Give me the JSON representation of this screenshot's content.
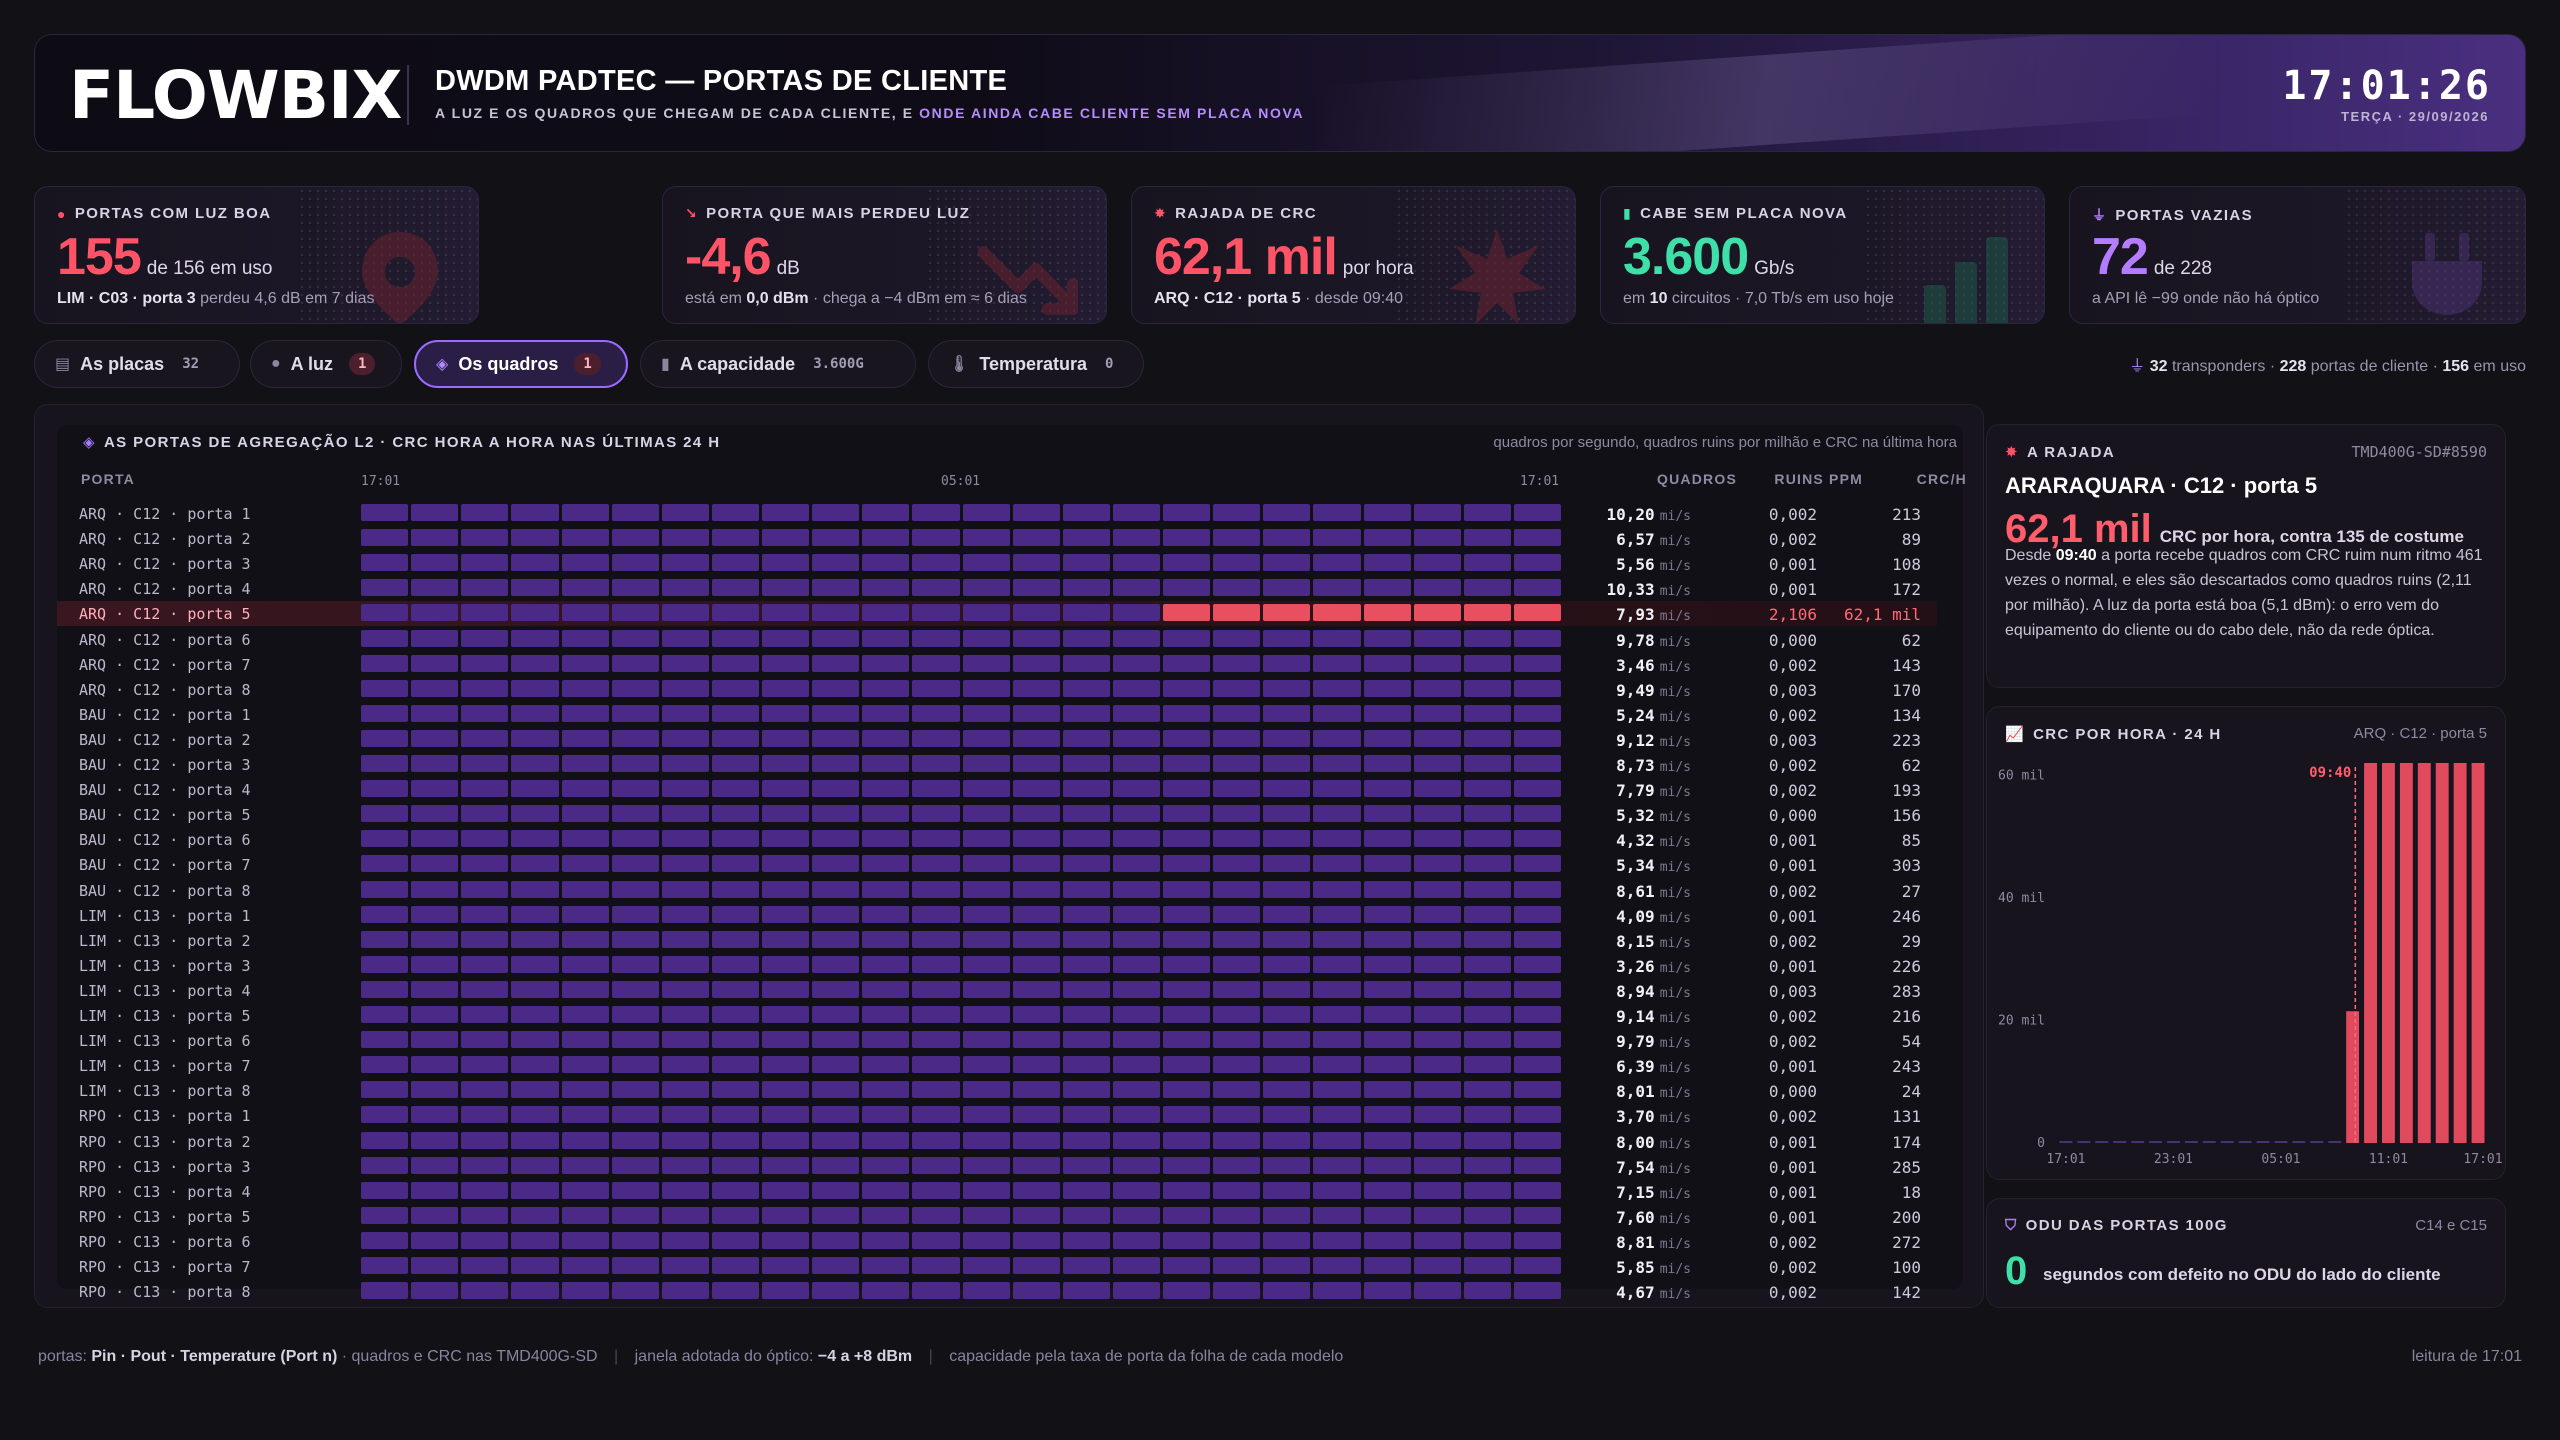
{
  "header": {
    "logo": "FLOWBIX",
    "title": "DWDM PADTEC — PORTAS DE CLIENTE",
    "subtitle_a": "A LUZ E OS QUADROS QUE CHEGAM DE CADA CLIENTE, E ",
    "subtitle_b": "ONDE AINDA CABE CLIENTE SEM PLACA NOVA",
    "clock": "17:01:26",
    "date": "TERÇA · 29/09/2026"
  },
  "kpis": [
    {
      "label": "PORTAS COM LUZ BOA",
      "value": "155",
      "unit": "de 156 em uso",
      "foot_b": "LIM · C03 · porta 3",
      "foot": " perdeu 4,6 dB em 7 dias",
      "color": "#ff5468",
      "icon": "pin-icon"
    },
    {
      "label": "PORTA QUE MAIS PERDEU LUZ",
      "value": "-4,6",
      "unit": "dB",
      "foot_a": "está em ",
      "foot_b": "0,0 dBm",
      "foot": " · chega a −4 dBm em ≈ 6 dias",
      "color": "#ff5468",
      "icon": "trend-down-icon"
    },
    {
      "label": "RAJADA DE CRC",
      "value": "62,1 mil",
      "unit": "por hora",
      "foot_b": "ARQ · C12 · porta 5",
      "foot": " · desde 09:40",
      "color": "#ff5468",
      "icon": "burst-icon"
    },
    {
      "label": "CABE SEM PLACA NOVA",
      "value": "3.600",
      "unit": "Gb/s",
      "foot_a": "em ",
      "foot_b": "10",
      "foot": " circuitos · 7,0 Tb/s em uso hoje",
      "color": "#3fe0a8",
      "icon": "bars-icon"
    },
    {
      "label": "PORTAS VAZIAS",
      "value": "72",
      "unit": "de 228",
      "foot": "a API lê −99 onde não há óptico",
      "color": "#b47cff",
      "icon": "plug-icon"
    }
  ],
  "tabs": [
    {
      "label": "As placas",
      "count": "32",
      "badge": false,
      "icon": "cards-icon"
    },
    {
      "label": "A luz",
      "count": "1",
      "badge": true,
      "icon": "pin-icon"
    },
    {
      "label": "Os quadros",
      "count": "1",
      "badge": true,
      "icon": "layers-icon",
      "active": true
    },
    {
      "label": "A capacidade",
      "count": "3.600G",
      "badge": false,
      "icon": "bars-icon"
    },
    {
      "label": "Temperatura",
      "count": "0",
      "badge": false,
      "icon": "thermo-icon"
    }
  ],
  "summary": {
    "transponders": "32",
    "transponders_label": "transponders",
    "ports": "228",
    "ports_label": "portas de cliente",
    "inuse": "156",
    "inuse_label": "em uso"
  },
  "panel": {
    "title": "AS PORTAS DE AGREGAÇÃO L2 · CRC HORA A HORA NAS ÚLTIMAS 24 H",
    "note": "quadros por segundo, quadros ruins por milhão e CRC na última hora",
    "col_port": "PORTA",
    "col_quadros": "QUADROS",
    "col_ppm": "RUINS PPM",
    "col_crc": "CRC/H",
    "ticks": [
      "17:01",
      "05:01",
      "17:01"
    ],
    "unit": "mi/s",
    "rows": [
      {
        "port": "ARQ · C12 · porta 1",
        "q": "10,20",
        "ppm": "0,002",
        "crc": "213"
      },
      {
        "port": "ARQ · C12 · porta 2",
        "q": "6,57",
        "ppm": "0,002",
        "crc": "89"
      },
      {
        "port": "ARQ · C12 · porta 3",
        "q": "5,56",
        "ppm": "0,001",
        "crc": "108"
      },
      {
        "port": "ARQ · C12 · porta 4",
        "q": "10,33",
        "ppm": "0,001",
        "crc": "172"
      },
      {
        "port": "ARQ · C12 · porta 5",
        "q": "7,93",
        "ppm": "2,106",
        "crc": "62,1 mil",
        "alert": true
      },
      {
        "port": "ARQ · C12 · porta 6",
        "q": "9,78",
        "ppm": "0,000",
        "crc": "62"
      },
      {
        "port": "ARQ · C12 · porta 7",
        "q": "3,46",
        "ppm": "0,002",
        "crc": "143"
      },
      {
        "port": "ARQ · C12 · porta 8",
        "q": "9,49",
        "ppm": "0,003",
        "crc": "170"
      },
      {
        "port": "BAU · C12 · porta 1",
        "q": "5,24",
        "ppm": "0,002",
        "crc": "134"
      },
      {
        "port": "BAU · C12 · porta 2",
        "q": "9,12",
        "ppm": "0,003",
        "crc": "223"
      },
      {
        "port": "BAU · C12 · porta 3",
        "q": "8,73",
        "ppm": "0,002",
        "crc": "62"
      },
      {
        "port": "BAU · C12 · porta 4",
        "q": "7,79",
        "ppm": "0,002",
        "crc": "193"
      },
      {
        "port": "BAU · C12 · porta 5",
        "q": "5,32",
        "ppm": "0,000",
        "crc": "156"
      },
      {
        "port": "BAU · C12 · porta 6",
        "q": "4,32",
        "ppm": "0,001",
        "crc": "85"
      },
      {
        "port": "BAU · C12 · porta 7",
        "q": "5,34",
        "ppm": "0,001",
        "crc": "303"
      },
      {
        "port": "BAU · C12 · porta 8",
        "q": "8,61",
        "ppm": "0,002",
        "crc": "27"
      },
      {
        "port": "LIM · C13 · porta 1",
        "q": "4,09",
        "ppm": "0,001",
        "crc": "246"
      },
      {
        "port": "LIM · C13 · porta 2",
        "q": "8,15",
        "ppm": "0,002",
        "crc": "29"
      },
      {
        "port": "LIM · C13 · porta 3",
        "q": "3,26",
        "ppm": "0,001",
        "crc": "226"
      },
      {
        "port": "LIM · C13 · porta 4",
        "q": "8,94",
        "ppm": "0,003",
        "crc": "283"
      },
      {
        "port": "LIM · C13 · porta 5",
        "q": "9,14",
        "ppm": "0,002",
        "crc": "216"
      },
      {
        "port": "LIM · C13 · porta 6",
        "q": "9,79",
        "ppm": "0,002",
        "crc": "54"
      },
      {
        "port": "LIM · C13 · porta 7",
        "q": "6,39",
        "ppm": "0,001",
        "crc": "243"
      },
      {
        "port": "LIM · C13 · porta 8",
        "q": "8,01",
        "ppm": "0,000",
        "crc": "24"
      },
      {
        "port": "RPO · C13 · porta 1",
        "q": "3,70",
        "ppm": "0,002",
        "crc": "131"
      },
      {
        "port": "RPO · C13 · porta 2",
        "q": "8,00",
        "ppm": "0,001",
        "crc": "174"
      },
      {
        "port": "RPO · C13 · porta 3",
        "q": "7,54",
        "ppm": "0,001",
        "crc": "285"
      },
      {
        "port": "RPO · C13 · porta 4",
        "q": "7,15",
        "ppm": "0,001",
        "crc": "18"
      },
      {
        "port": "RPO · C13 · porta 5",
        "q": "7,60",
        "ppm": "0,001",
        "crc": "200"
      },
      {
        "port": "RPO · C13 · porta 6",
        "q": "8,81",
        "ppm": "0,002",
        "crc": "272"
      },
      {
        "port": "RPO · C13 · porta 7",
        "q": "5,85",
        "ppm": "0,002",
        "crc": "100"
      },
      {
        "port": "RPO · C13 · porta 8",
        "q": "4,67",
        "ppm": "0,002",
        "crc": "142"
      }
    ],
    "hours_total": 24,
    "alert_from_hour": 16
  },
  "rajada": {
    "title": "A RAJADA",
    "ref": "TMD400G-SD#8590",
    "name": "ARARAQUARA · C12 · porta 5",
    "big": "62,1 mil",
    "big_rest": "CRC por hora, contra 135 de costume",
    "text_a": "Desde ",
    "text_b": "09:40",
    "text_c": " a porta recebe quadros com CRC ruim num ritmo 461 vezes o normal, e eles são descartados como quadros ruins (2,11 por milhão). A luz da porta está boa (5,1 dBm): o erro vem do equipamento do cliente ou do cabo dele, não da rede óptica."
  },
  "crc_chart": {
    "title": "CRC POR HORA · 24 H",
    "ref": "ARQ · C12 · porta 5",
    "marker": "09:40",
    "yticks": [
      "60 mil",
      "40 mil",
      "20 mil",
      "0"
    ],
    "xticks": [
      "17:01",
      "23:01",
      "05:01",
      "11:01",
      "17:01"
    ]
  },
  "chart_data": {
    "type": "bar",
    "title": "CRC POR HORA · 24 H",
    "xlabel": "",
    "ylabel": "",
    "ylim": [
      0,
      62000
    ],
    "categories": [
      "17:01",
      "18:01",
      "19:01",
      "20:01",
      "21:01",
      "22:01",
      "23:01",
      "00:01",
      "01:01",
      "02:01",
      "03:01",
      "04:01",
      "05:01",
      "06:01",
      "07:01",
      "08:01",
      "09:01",
      "10:01",
      "11:01",
      "12:01",
      "13:01",
      "14:01",
      "15:01",
      "16:01"
    ],
    "values": [
      140,
      135,
      130,
      138,
      142,
      136,
      133,
      139,
      131,
      137,
      134,
      140,
      136,
      132,
      138,
      135,
      21500,
      62000,
      62000,
      62000,
      62000,
      62000,
      62000,
      62000
    ],
    "annotation": "09:40",
    "grid": false,
    "color": "#e04a5c"
  },
  "odu": {
    "title": "ODU DAS PORTAS 100G",
    "ref": "C14 e C15",
    "value": "0",
    "text": "segundos com defeito no ODU do lado do cliente"
  },
  "footer": {
    "a_label": "portas: ",
    "a_bold": "Pin · Pout · Temperature (Port n)",
    "a_rest": " · quadros e CRC nas TMD400G-SD",
    "b_label": "janela adotada do óptico: ",
    "b_bold": "−4 a +8 dBm",
    "c": "capacidade pela taxa de porta da folha de cada modelo",
    "right": "leitura de 17:01"
  },
  "colors": {
    "accent": "#9b6bff",
    "alert": "#e8505f",
    "ok": "#3fe0a8",
    "cell": "#4a2a86"
  }
}
